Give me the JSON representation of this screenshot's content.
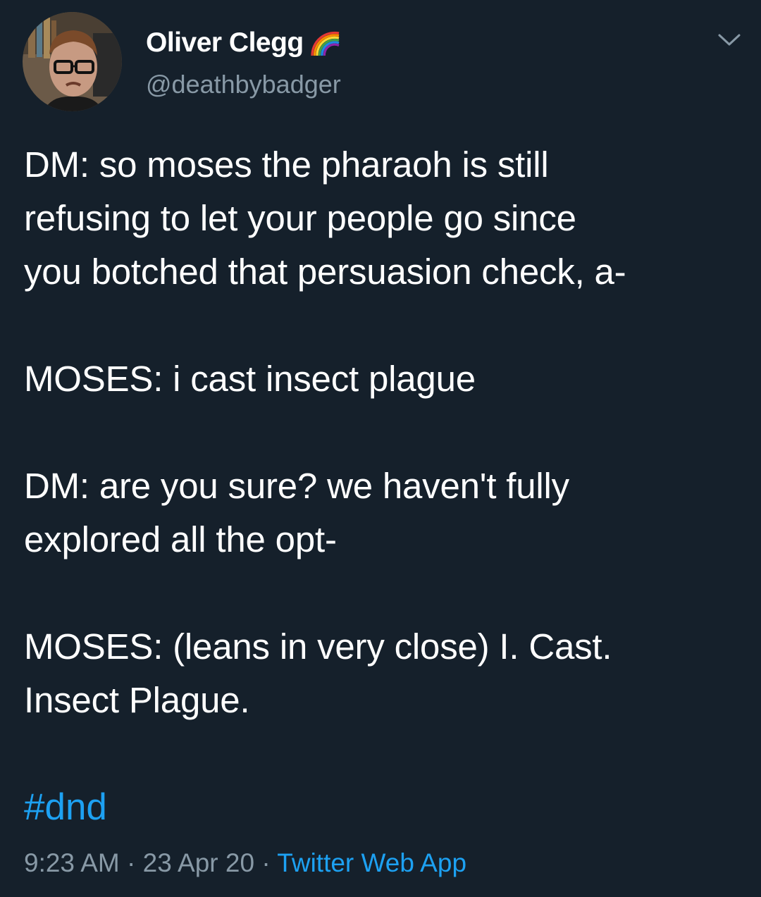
{
  "tweet": {
    "author": {
      "display_name": "Oliver Clegg",
      "handle": "@deathbybadger",
      "badge_icon": "rainbow-icon",
      "avatar_icon": "profile-avatar"
    },
    "menu_icon": "chevron-down-icon",
    "paragraphs": [
      [
        "DM: so moses the pharaoh is still",
        "refusing to let your people go since",
        "you botched that persuasion check, a-"
      ],
      [
        "MOSES: i cast insect plague"
      ],
      [
        "DM: are you sure? we haven't fully",
        "explored all the opt-"
      ],
      [
        "MOSES: (leans in very close) I. Cast.",
        "Insect Plague."
      ]
    ],
    "hashtag": "#dnd",
    "time": "9:23 AM",
    "date": "23 Apr 20",
    "separator": "·",
    "source": "Twitter Web App"
  },
  "colors": {
    "background": "#15202b",
    "text": "#ffffff",
    "secondary": "#8899a6",
    "link": "#1da1f2"
  }
}
